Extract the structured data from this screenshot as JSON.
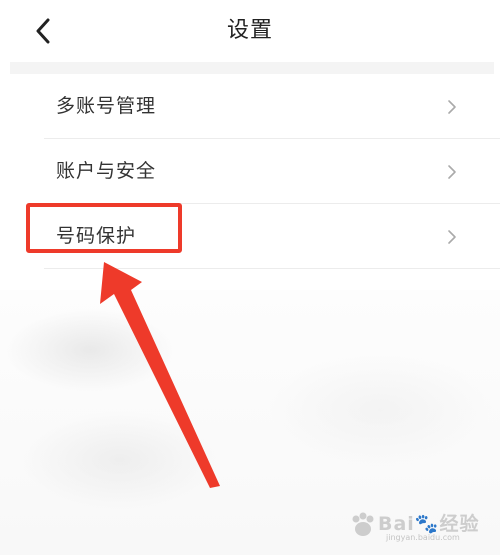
{
  "navbar": {
    "title": "设置",
    "back_icon": "chevron-left-icon"
  },
  "menu": {
    "items": [
      {
        "label": "多账号管理",
        "icon": "chevron-right-icon"
      },
      {
        "label": "账户与安全",
        "icon": "chevron-right-icon"
      },
      {
        "label": "号码保护",
        "icon": "chevron-right-icon"
      }
    ]
  },
  "annotation": {
    "highlight_color": "#ee3a2a",
    "highlighted_item": "号码保护"
  },
  "watermark": {
    "main": "Bai🐾经验",
    "sub": "jingyan.baidu.com"
  }
}
